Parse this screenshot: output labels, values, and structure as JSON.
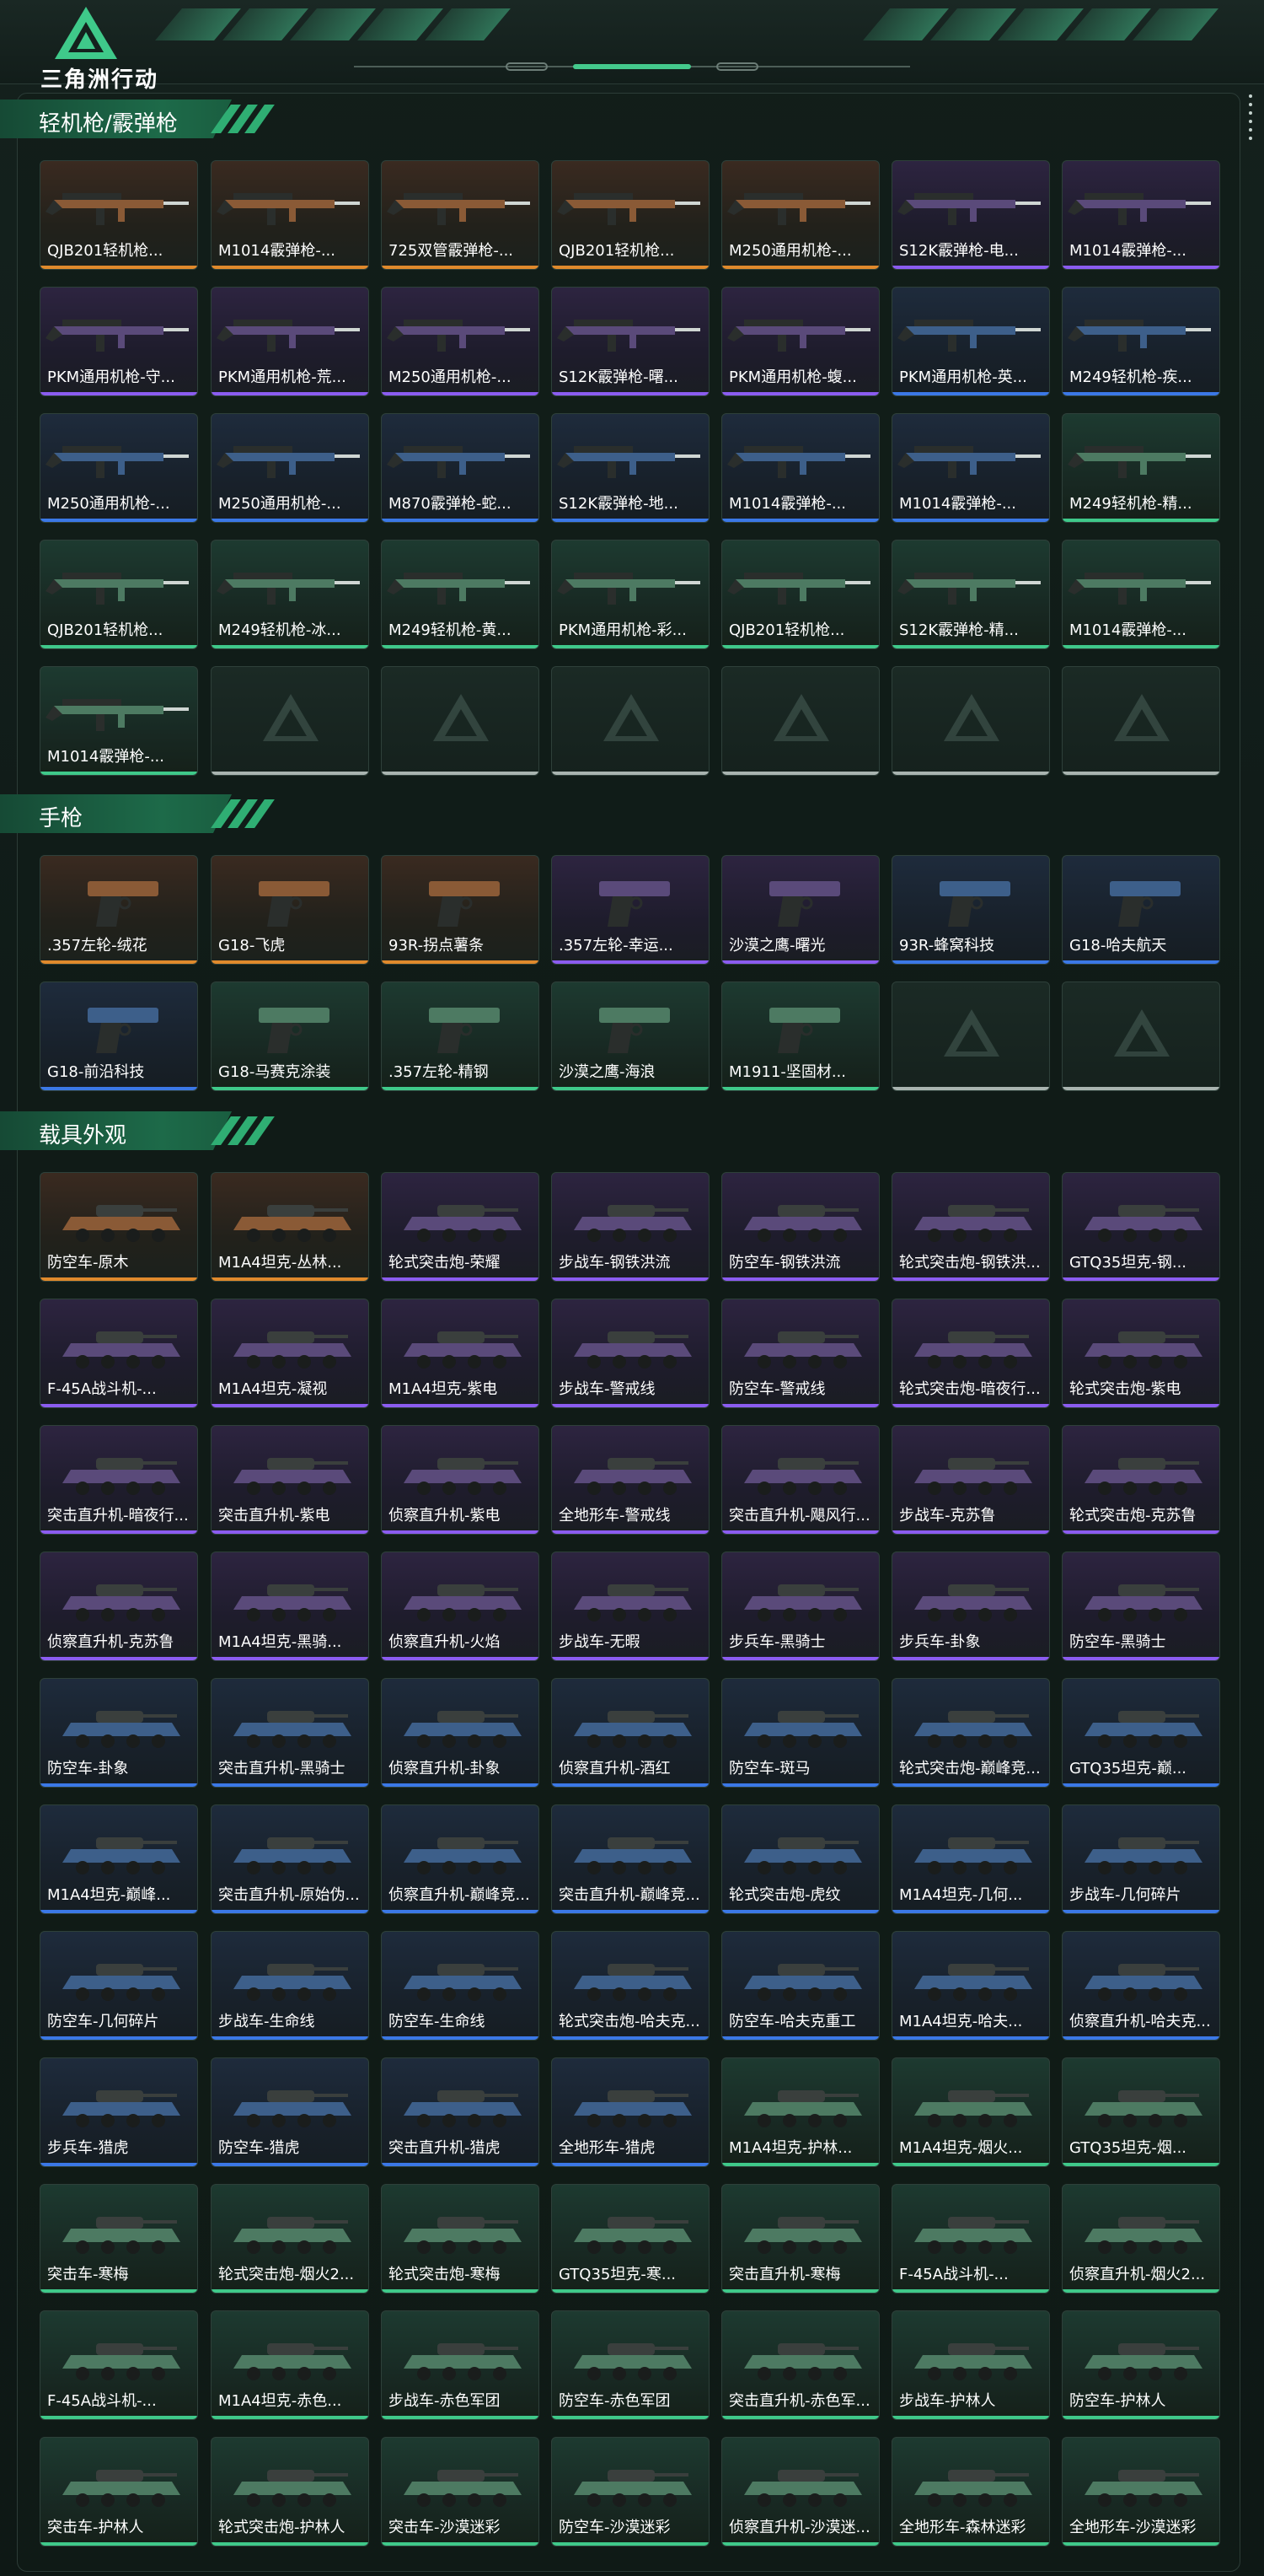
{
  "app": {
    "logo_text": "三角洲行动"
  },
  "colors": {
    "orange": "#e08a2c",
    "purple": "#8b5cf0",
    "blue": "#3b78e6",
    "green": "#3fc98a",
    "accent": "#2fae73"
  },
  "sections": [
    {
      "title": "轻机枪/霰弹枪",
      "kind": "gun",
      "items": [
        {
          "label": "QJB201轻机枪...",
          "rarity": "orange"
        },
        {
          "label": "M1014霰弹枪-...",
          "rarity": "orange"
        },
        {
          "label": "725双管霰弹枪-...",
          "rarity": "orange"
        },
        {
          "label": "QJB201轻机枪...",
          "rarity": "orange"
        },
        {
          "label": "M250通用机枪-...",
          "rarity": "orange"
        },
        {
          "label": "S12K霰弹枪-电...",
          "rarity": "purple"
        },
        {
          "label": "M1014霰弹枪-...",
          "rarity": "purple"
        },
        {
          "label": "PKM通用机枪-守...",
          "rarity": "purple"
        },
        {
          "label": "PKM通用机枪-荒...",
          "rarity": "purple"
        },
        {
          "label": "M250通用机枪-...",
          "rarity": "purple"
        },
        {
          "label": "S12K霰弹枪-曙...",
          "rarity": "purple"
        },
        {
          "label": "PKM通用机枪-蝮...",
          "rarity": "purple"
        },
        {
          "label": "PKM通用机枪-英...",
          "rarity": "blue"
        },
        {
          "label": "M249轻机枪-疾...",
          "rarity": "blue"
        },
        {
          "label": "M250通用机枪-...",
          "rarity": "blue"
        },
        {
          "label": "M250通用机枪-...",
          "rarity": "blue"
        },
        {
          "label": "M870霰弹枪-蛇...",
          "rarity": "blue"
        },
        {
          "label": "S12K霰弹枪-地...",
          "rarity": "blue"
        },
        {
          "label": "M1014霰弹枪-...",
          "rarity": "blue"
        },
        {
          "label": "M1014霰弹枪-...",
          "rarity": "blue"
        },
        {
          "label": "M249轻机枪-精...",
          "rarity": "green"
        },
        {
          "label": "QJB201轻机枪...",
          "rarity": "green"
        },
        {
          "label": "M249轻机枪-冰...",
          "rarity": "green"
        },
        {
          "label": "M249轻机枪-黄...",
          "rarity": "green"
        },
        {
          "label": "PKM通用机枪-彩...",
          "rarity": "green"
        },
        {
          "label": "QJB201轻机枪...",
          "rarity": "green"
        },
        {
          "label": "S12K霰弹枪-精...",
          "rarity": "green"
        },
        {
          "label": "M1014霰弹枪-...",
          "rarity": "green"
        },
        {
          "label": "M1014霰弹枪-...",
          "rarity": "green"
        },
        {
          "label": "",
          "rarity": "empty"
        },
        {
          "label": "",
          "rarity": "empty"
        },
        {
          "label": "",
          "rarity": "empty"
        },
        {
          "label": "",
          "rarity": "empty"
        },
        {
          "label": "",
          "rarity": "empty"
        },
        {
          "label": "",
          "rarity": "empty"
        }
      ]
    },
    {
      "title": "手枪",
      "kind": "pistol",
      "items": [
        {
          "label": ".357左轮-绒花",
          "rarity": "orange"
        },
        {
          "label": "G18-飞虎",
          "rarity": "orange"
        },
        {
          "label": "93R-拐点薯条",
          "rarity": "orange"
        },
        {
          "label": ".357左轮-幸运...",
          "rarity": "purple"
        },
        {
          "label": "沙漠之鹰-曙光",
          "rarity": "purple"
        },
        {
          "label": "93R-蜂窝科技",
          "rarity": "blue"
        },
        {
          "label": "G18-哈夫航天",
          "rarity": "blue"
        },
        {
          "label": "G18-前沿科技",
          "rarity": "blue"
        },
        {
          "label": "G18-马赛克涂装",
          "rarity": "green"
        },
        {
          "label": ".357左轮-精钢",
          "rarity": "green"
        },
        {
          "label": "沙漠之鹰-海浪",
          "rarity": "green"
        },
        {
          "label": "M1911-坚固材...",
          "rarity": "green"
        },
        {
          "label": "",
          "rarity": "empty"
        },
        {
          "label": "",
          "rarity": "empty"
        }
      ]
    },
    {
      "title": "载具外观",
      "kind": "vehicle",
      "items": [
        {
          "label": "防空车-原木",
          "rarity": "orange"
        },
        {
          "label": "M1A4坦克-丛林...",
          "rarity": "orange"
        },
        {
          "label": "轮式突击炮-荣耀",
          "rarity": "purple"
        },
        {
          "label": "步战车-钢铁洪流",
          "rarity": "purple"
        },
        {
          "label": "防空车-钢铁洪流",
          "rarity": "purple"
        },
        {
          "label": "轮式突击炮-钢铁洪...",
          "rarity": "purple"
        },
        {
          "label": "GTQ35坦克-钢...",
          "rarity": "purple"
        },
        {
          "label": "F-45A战斗机-...",
          "rarity": "purple"
        },
        {
          "label": "M1A4坦克-凝视",
          "rarity": "purple"
        },
        {
          "label": "M1A4坦克-紫电",
          "rarity": "purple"
        },
        {
          "label": "步战车-警戒线",
          "rarity": "purple"
        },
        {
          "label": "防空车-警戒线",
          "rarity": "purple"
        },
        {
          "label": "轮式突击炮-暗夜行...",
          "rarity": "purple"
        },
        {
          "label": "轮式突击炮-紫电",
          "rarity": "purple"
        },
        {
          "label": "突击直升机-暗夜行...",
          "rarity": "purple"
        },
        {
          "label": "突击直升机-紫电",
          "rarity": "purple"
        },
        {
          "label": "侦察直升机-紫电",
          "rarity": "purple"
        },
        {
          "label": "全地形车-警戒线",
          "rarity": "purple"
        },
        {
          "label": "突击直升机-飓风行...",
          "rarity": "purple"
        },
        {
          "label": "步战车-克苏鲁",
          "rarity": "purple"
        },
        {
          "label": "轮式突击炮-克苏鲁",
          "rarity": "purple"
        },
        {
          "label": "侦察直升机-克苏鲁",
          "rarity": "purple"
        },
        {
          "label": "M1A4坦克-黑骑...",
          "rarity": "purple"
        },
        {
          "label": "侦察直升机-火焰",
          "rarity": "purple"
        },
        {
          "label": "步战车-无暇",
          "rarity": "purple"
        },
        {
          "label": "步兵车-黑骑士",
          "rarity": "purple"
        },
        {
          "label": "步兵车-卦象",
          "rarity": "purple"
        },
        {
          "label": "防空车-黑骑士",
          "rarity": "purple"
        },
        {
          "label": "防空车-卦象",
          "rarity": "blue"
        },
        {
          "label": "突击直升机-黑骑士",
          "rarity": "blue"
        },
        {
          "label": "侦察直升机-卦象",
          "rarity": "blue"
        },
        {
          "label": "侦察直升机-酒红",
          "rarity": "blue"
        },
        {
          "label": "防空车-斑马",
          "rarity": "blue"
        },
        {
          "label": "轮式突击炮-巅峰竞...",
          "rarity": "blue"
        },
        {
          "label": "GTQ35坦克-巅...",
          "rarity": "blue"
        },
        {
          "label": "M1A4坦克-巅峰...",
          "rarity": "blue"
        },
        {
          "label": "突击直升机-原始伪...",
          "rarity": "blue"
        },
        {
          "label": "侦察直升机-巅峰竞...",
          "rarity": "blue"
        },
        {
          "label": "突击直升机-巅峰竞...",
          "rarity": "blue"
        },
        {
          "label": "轮式突击炮-虎纹",
          "rarity": "blue"
        },
        {
          "label": "M1A4坦克-几何...",
          "rarity": "blue"
        },
        {
          "label": "步战车-几何碎片",
          "rarity": "blue"
        },
        {
          "label": "防空车-几何碎片",
          "rarity": "blue"
        },
        {
          "label": "步战车-生命线",
          "rarity": "blue"
        },
        {
          "label": "防空车-生命线",
          "rarity": "blue"
        },
        {
          "label": "轮式突击炮-哈夫克...",
          "rarity": "blue"
        },
        {
          "label": "防空车-哈夫克重工",
          "rarity": "blue"
        },
        {
          "label": "M1A4坦克-哈夫...",
          "rarity": "blue"
        },
        {
          "label": "侦察直升机-哈夫克...",
          "rarity": "blue"
        },
        {
          "label": "步兵车-猎虎",
          "rarity": "blue"
        },
        {
          "label": "防空车-猎虎",
          "rarity": "blue"
        },
        {
          "label": "突击直升机-猎虎",
          "rarity": "blue"
        },
        {
          "label": "全地形车-猎虎",
          "rarity": "blue"
        },
        {
          "label": "M1A4坦克-护林...",
          "rarity": "green"
        },
        {
          "label": "M1A4坦克-烟火...",
          "rarity": "green"
        },
        {
          "label": "GTQ35坦克-烟...",
          "rarity": "green"
        },
        {
          "label": "突击车-寒梅",
          "rarity": "green"
        },
        {
          "label": "轮式突击炮-烟火2...",
          "rarity": "green"
        },
        {
          "label": "轮式突击炮-寒梅",
          "rarity": "green"
        },
        {
          "label": "GTQ35坦克-寒...",
          "rarity": "green"
        },
        {
          "label": "突击直升机-寒梅",
          "rarity": "green"
        },
        {
          "label": "F-45A战斗机-...",
          "rarity": "green"
        },
        {
          "label": "侦察直升机-烟火2...",
          "rarity": "green"
        },
        {
          "label": "F-45A战斗机-...",
          "rarity": "green"
        },
        {
          "label": "M1A4坦克-赤色...",
          "rarity": "green"
        },
        {
          "label": "步战车-赤色军团",
          "rarity": "green"
        },
        {
          "label": "防空车-赤色军团",
          "rarity": "green"
        },
        {
          "label": "突击直升机-赤色军...",
          "rarity": "green"
        },
        {
          "label": "步战车-护林人",
          "rarity": "green"
        },
        {
          "label": "防空车-护林人",
          "rarity": "green"
        },
        {
          "label": "突击车-护林人",
          "rarity": "green"
        },
        {
          "label": "轮式突击炮-护林人",
          "rarity": "green"
        },
        {
          "label": "突击车-沙漠迷彩",
          "rarity": "green"
        },
        {
          "label": "防空车-沙漠迷彩",
          "rarity": "green"
        },
        {
          "label": "侦察直升机-沙漠迷...",
          "rarity": "green"
        },
        {
          "label": "全地形车-森林迷彩",
          "rarity": "green"
        },
        {
          "label": "全地形车-沙漠迷彩",
          "rarity": "green"
        }
      ]
    }
  ]
}
